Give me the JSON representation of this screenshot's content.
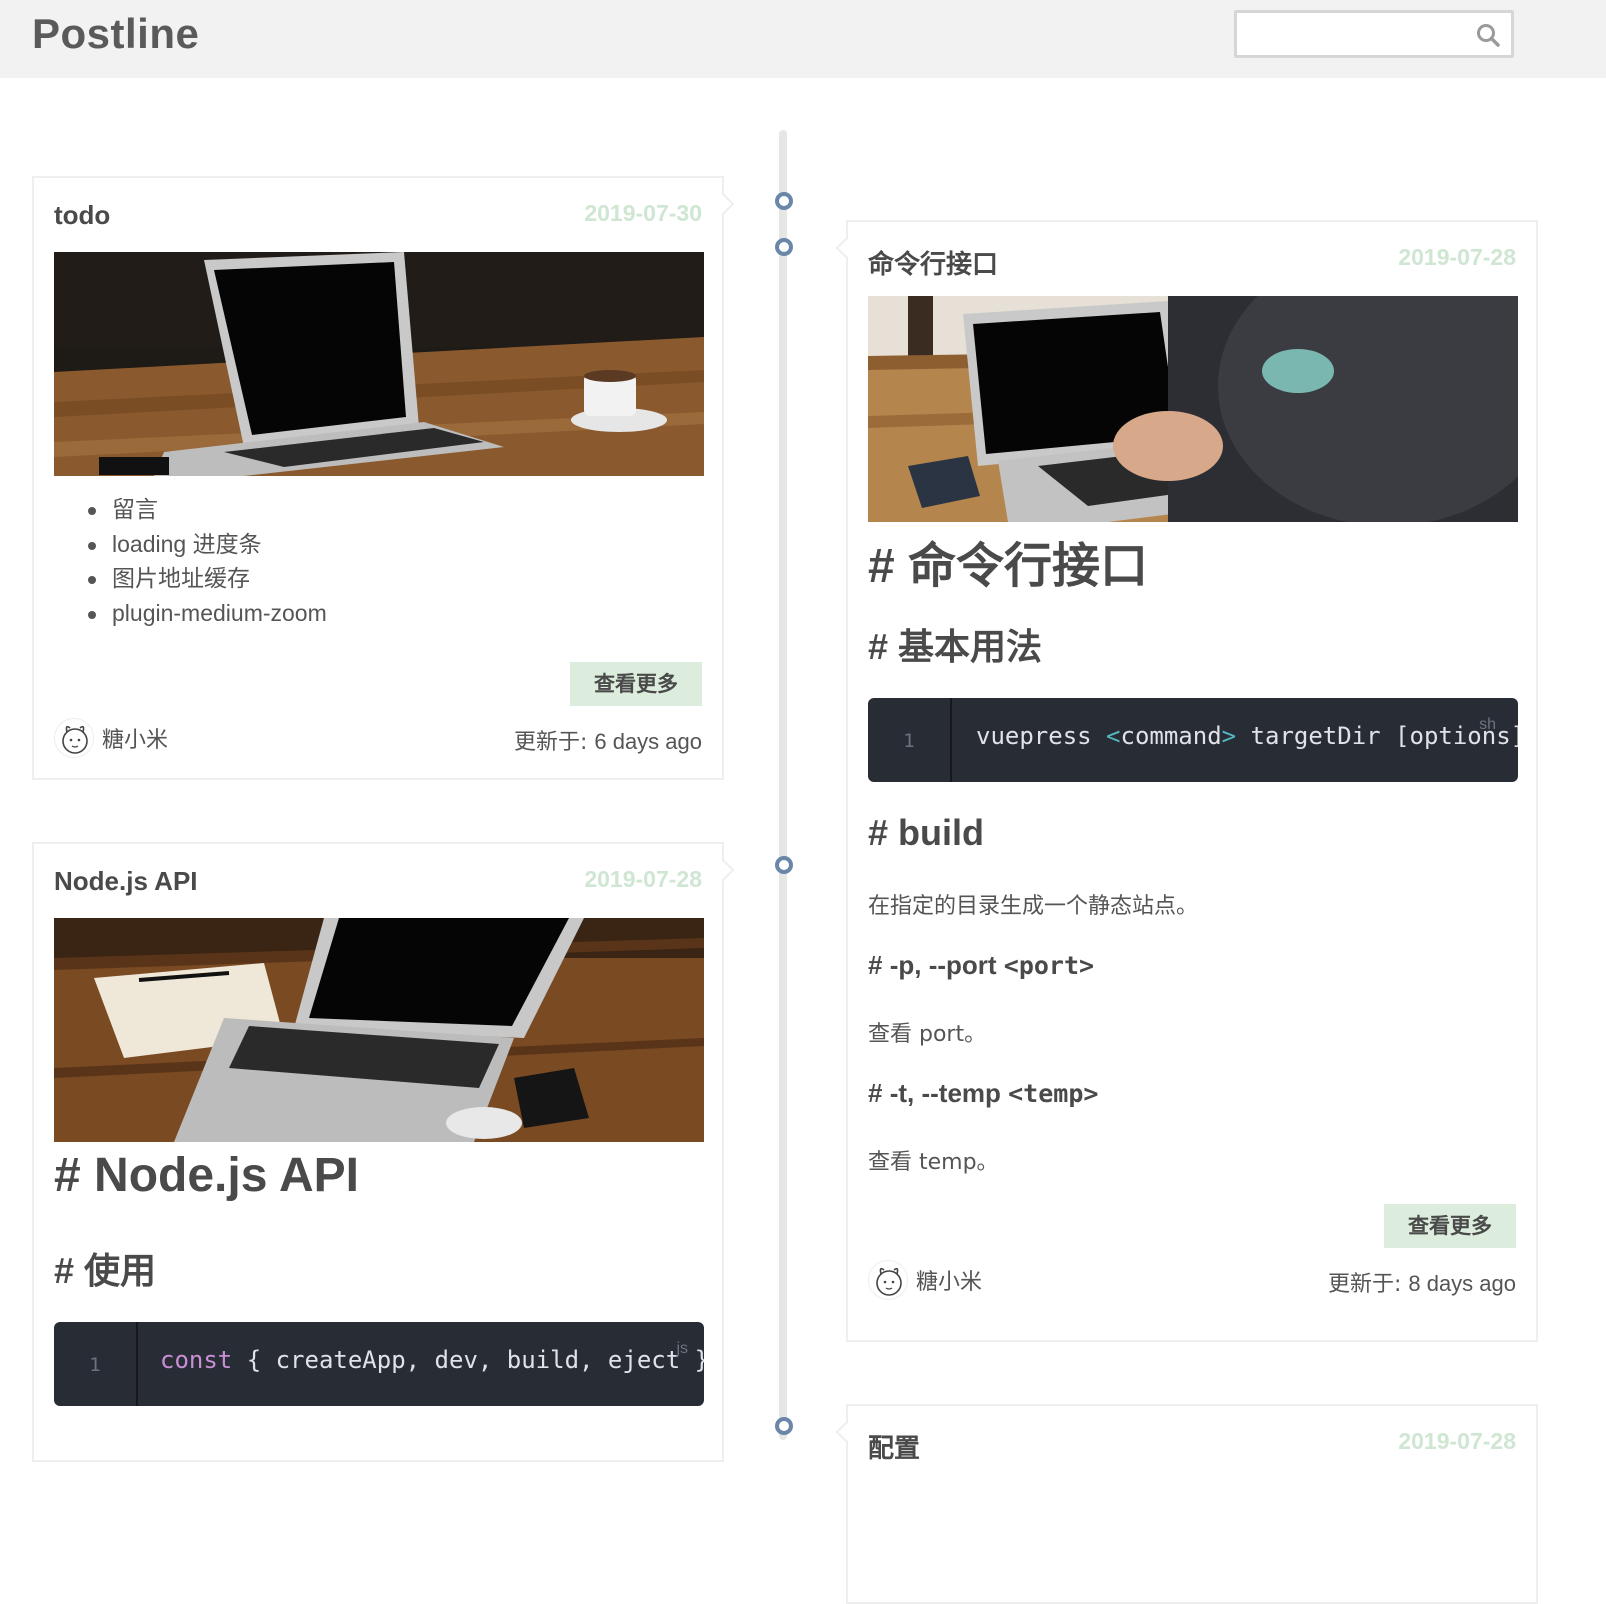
{
  "header": {
    "brand": "Postline",
    "search": {
      "placeholder": "",
      "value": "",
      "icon": "search-icon"
    }
  },
  "colors": {
    "accent_green_light": "#dcecdd",
    "date_green": "#cfe6d2",
    "timeline_node": "#6b86a8",
    "code_bg": "#282c34"
  },
  "posts": [
    {
      "title": "todo",
      "date": "2019-07-30",
      "image": "laptop-on-wooden-table-with-coffee-cup",
      "list": [
        "留言",
        "loading 进度条",
        "图片地址缓存",
        "plugin-medium-zoom"
      ],
      "more_label": "查看更多",
      "author": "糖小米",
      "updated_label": "更新于:",
      "updated_value": "6 days ago"
    },
    {
      "title": "命令行接口",
      "date": "2019-07-28",
      "image": "person-typing-on-laptop",
      "h1": "命令行接口",
      "h2_usage": "基本用法",
      "code": {
        "line": "1",
        "lang": "sh",
        "tokens": [
          "vuepress ",
          "<",
          "command",
          ">",
          " targetDir [options]"
        ]
      },
      "h2_build": "build",
      "build_desc": "在指定的目录生成一个静态站点。",
      "opt_port": {
        "flag": "-p, --port ",
        "arg": "<port>",
        "desc": "查看 port。"
      },
      "opt_temp": {
        "flag": "-t, --temp ",
        "arg": "<temp>",
        "desc": "查看 temp。"
      },
      "more_label": "查看更多",
      "author": "糖小米",
      "updated_label": "更新于:",
      "updated_value": "8 days ago"
    },
    {
      "title": "Node.js API",
      "date": "2019-07-28",
      "image": "laptop-with-notebook-and-pen",
      "h1": "Node.js API",
      "h2_use": "使用",
      "code": {
        "line": "1",
        "lang": "js",
        "tokens": [
          "const",
          " { createApp, dev, build, eject }"
        ]
      }
    },
    {
      "title": "配置",
      "date": "2019-07-28"
    }
  ],
  "hash": "#"
}
